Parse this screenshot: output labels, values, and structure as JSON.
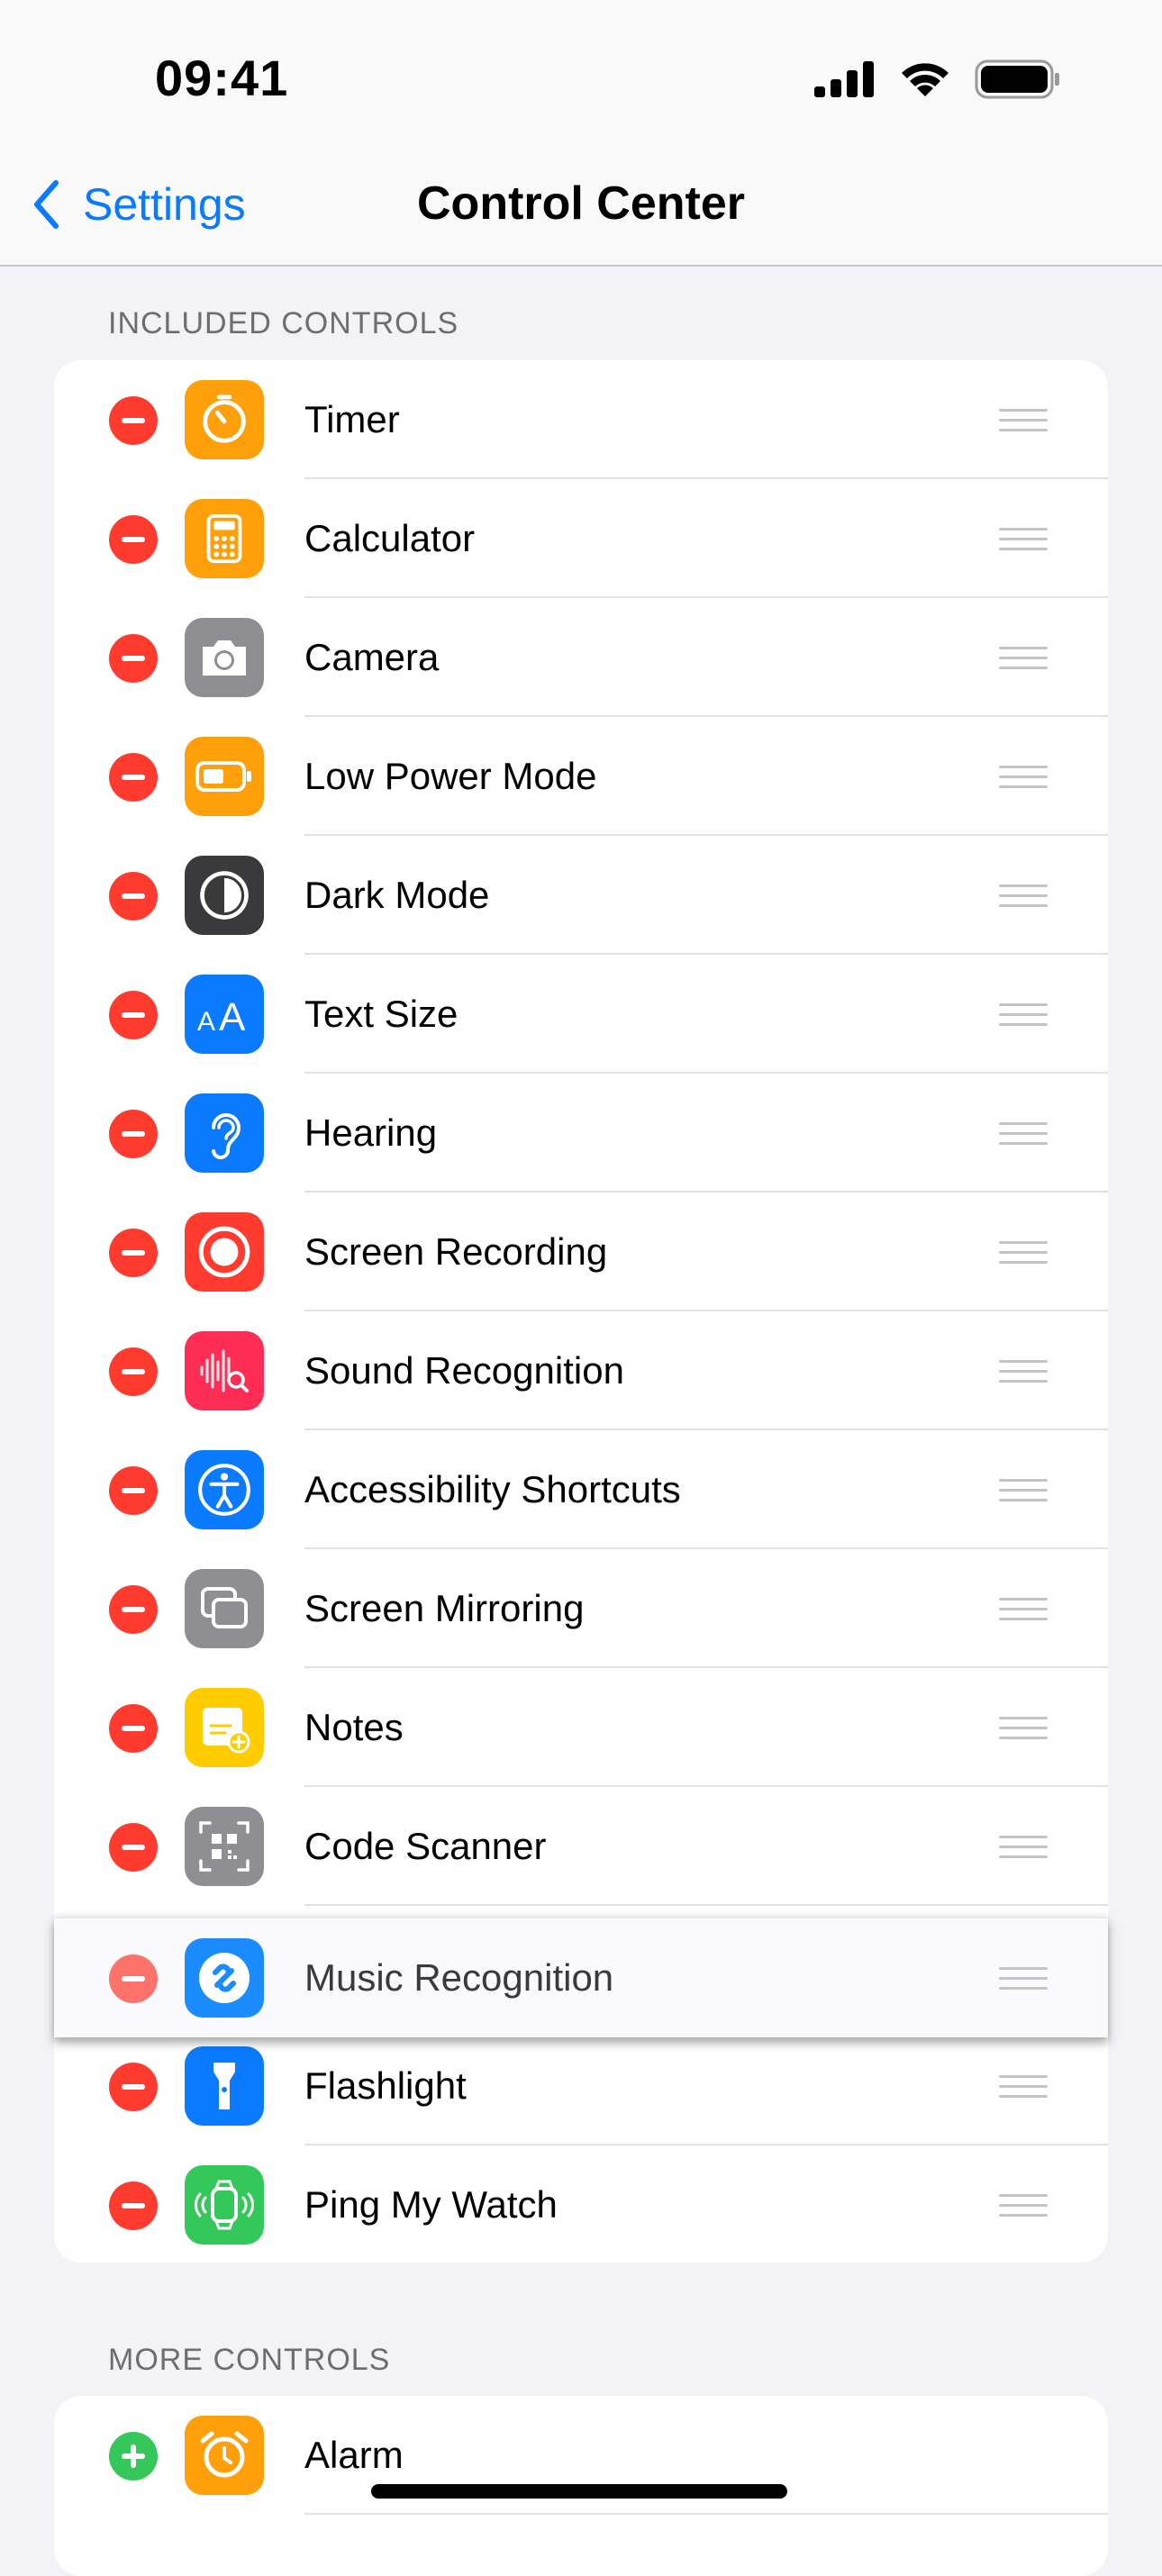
{
  "status_bar": {
    "time": "09:41"
  },
  "nav": {
    "back_label": "Settings",
    "title": "Control Center"
  },
  "included": {
    "header": "INCLUDED CONTROLS",
    "items": [
      {
        "label": "Timer",
        "icon": "timer-icon",
        "color": "#ff9f0a"
      },
      {
        "label": "Calculator",
        "icon": "calculator-icon",
        "color": "#ff9f0a"
      },
      {
        "label": "Camera",
        "icon": "camera-icon",
        "color": "#8e8e93"
      },
      {
        "label": "Low Power Mode",
        "icon": "battery-icon",
        "color": "#ff9f0a"
      },
      {
        "label": "Dark Mode",
        "icon": "dark-mode-icon",
        "color": "#3a3a3c"
      },
      {
        "label": "Text Size",
        "icon": "text-size-icon",
        "color": "#0a7aff"
      },
      {
        "label": "Hearing",
        "icon": "ear-icon",
        "color": "#0a7aff"
      },
      {
        "label": "Screen Recording",
        "icon": "record-icon",
        "color": "#ff3b30"
      },
      {
        "label": "Sound Recognition",
        "icon": "waveform-search-icon",
        "color": "#ff2d55"
      },
      {
        "label": "Accessibility Shortcuts",
        "icon": "accessibility-icon",
        "color": "#0a7aff"
      },
      {
        "label": "Screen Mirroring",
        "icon": "screen-mirroring-icon",
        "color": "#8e8e93"
      },
      {
        "label": "Notes",
        "icon": "notes-icon",
        "color": "#ffcc00"
      },
      {
        "label": "Code Scanner",
        "icon": "qr-code-icon",
        "color": "#8e8e93"
      },
      {
        "label": "Flashlight",
        "icon": "flashlight-icon",
        "color": "#0a7aff"
      },
      {
        "label": "Ping My Watch",
        "icon": "watch-icon",
        "color": "#34c759"
      }
    ],
    "dragging_item": {
      "label": "Music Recognition",
      "icon": "shazam-icon",
      "color": "#1a8cff"
    }
  },
  "more": {
    "header": "MORE CONTROLS",
    "items": [
      {
        "label": "Alarm",
        "icon": "alarm-icon",
        "color": "#ff9f0a"
      }
    ]
  }
}
